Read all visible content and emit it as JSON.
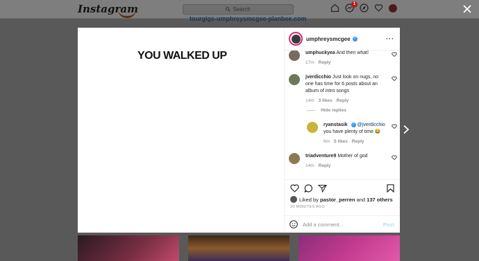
{
  "topbar": {
    "logo": "Instagram",
    "search_placeholder": "Search",
    "notif_count": "1"
  },
  "background_link": "tourgigs-umphreysmcgee-planbee.com",
  "post": {
    "image_text": "YOU WALKED UP",
    "author": "umphreysmcgee",
    "comments": [
      {
        "user": "umphuckyea",
        "text": "And then what!",
        "time": "17m",
        "reply": "Reply"
      },
      {
        "user": "jverdicchio",
        "text": "Just look on nugs, no one has time for 6 posts about an album of intro songs",
        "time": "14m",
        "likes": "3 likes",
        "reply": "Reply"
      },
      {
        "hide_replies": "Hide replies"
      },
      {
        "user": "ryanstasik",
        "mention": "@jverdicchio",
        "text": "you have plenty of time 😂",
        "time": "6m",
        "likes": "5 likes",
        "reply": "Reply"
      },
      {
        "user": "triadventure9",
        "text": "Mother of god",
        "time": "14m",
        "reply": "Reply"
      }
    ],
    "liked_by_prefix": "Liked by",
    "liked_by_user": "pastor_perren",
    "liked_by_and": "and",
    "liked_by_others": "137 others",
    "timestamp": "20 MINUTES AGO",
    "add_comment_placeholder": "Add a comment...",
    "post_button": "Post"
  },
  "colors": {
    "verified": "#3897f0",
    "post_button": "#b2dffc",
    "link": "#00376b"
  }
}
